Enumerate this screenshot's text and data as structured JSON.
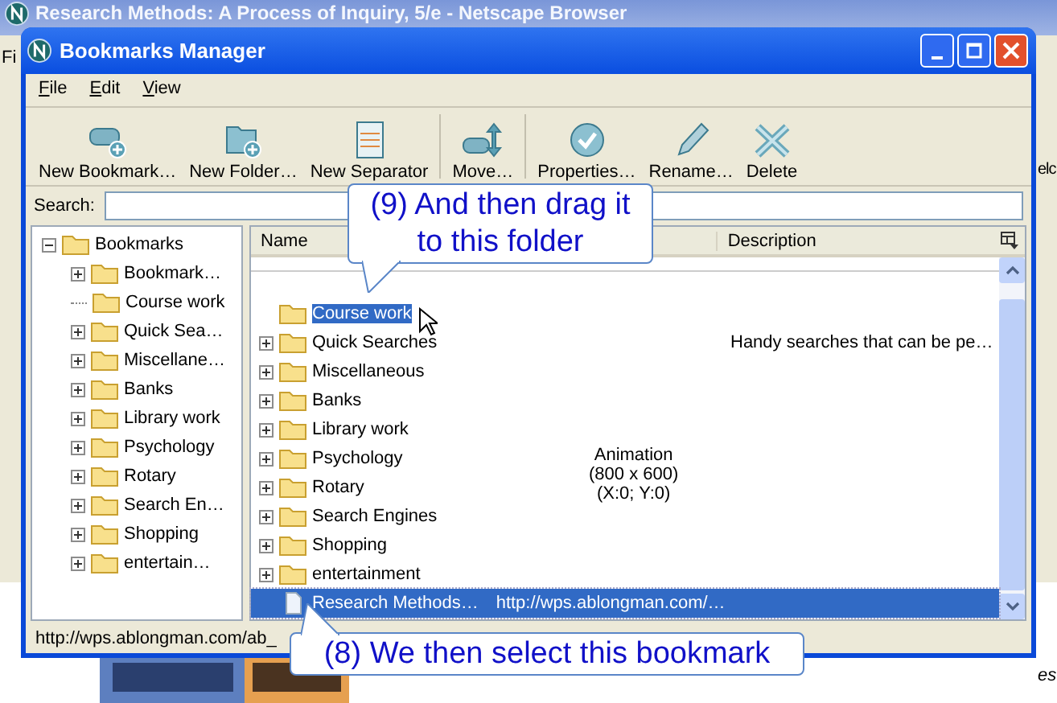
{
  "browser": {
    "title": "Research Methods: A Process of Inquiry, 5/e - Netscape Browser",
    "menu_fragment": "Fi",
    "side_fragment": "elc",
    "bottom_fragment": "es"
  },
  "dialog": {
    "title": "Bookmarks Manager"
  },
  "menu": [
    "File",
    "Edit",
    "View"
  ],
  "toolbar": [
    {
      "label": "New Bookmark…",
      "kind": "new-bookmark",
      "separator_before": false
    },
    {
      "label": "New Folder…",
      "kind": "new-folder",
      "separator_before": false
    },
    {
      "label": "New Separator",
      "kind": "new-separator",
      "separator_before": false
    },
    {
      "label": "Move…",
      "kind": "move",
      "separator_before": true
    },
    {
      "label": "Properties…",
      "kind": "properties",
      "separator_before": true
    },
    {
      "label": "Rename…",
      "kind": "rename",
      "separator_before": false
    },
    {
      "label": "Delete",
      "kind": "delete",
      "separator_before": false
    }
  ],
  "search": {
    "label": "Search:"
  },
  "tree": {
    "label": "Bookmarks",
    "expanded": true,
    "children": [
      {
        "label": "Bookmark…",
        "expandable": true
      },
      {
        "label": "Course work",
        "expandable": false
      },
      {
        "label": "Quick Sea…",
        "expandable": true
      },
      {
        "label": "Miscellane…",
        "expandable": true
      },
      {
        "label": "Banks",
        "expandable": true
      },
      {
        "label": "Library work",
        "expandable": true
      },
      {
        "label": "Psychology",
        "expandable": true
      },
      {
        "label": "Rotary",
        "expandable": true
      },
      {
        "label": "Search En…",
        "expandable": true
      },
      {
        "label": "Shopping",
        "expandable": true
      },
      {
        "label": "entertain…",
        "expandable": true
      }
    ]
  },
  "list": {
    "columns": [
      "Name",
      "Description"
    ],
    "rows": [
      {
        "kind": "folder",
        "name": "Course work",
        "expandable": false,
        "drop_target": true,
        "selected": false
      },
      {
        "kind": "folder",
        "name": "Quick Searches",
        "expandable": true,
        "drop_target": false,
        "selected": false,
        "description": "Handy searches that can be pe…"
      },
      {
        "kind": "folder",
        "name": "Miscellaneous",
        "expandable": true,
        "drop_target": false,
        "selected": false
      },
      {
        "kind": "folder",
        "name": "Banks",
        "expandable": true,
        "drop_target": false,
        "selected": false
      },
      {
        "kind": "folder",
        "name": "Library work",
        "expandable": true,
        "drop_target": false,
        "selected": false
      },
      {
        "kind": "folder",
        "name": "Psychology",
        "expandable": true,
        "drop_target": false,
        "selected": false
      },
      {
        "kind": "folder",
        "name": "Rotary",
        "expandable": true,
        "drop_target": false,
        "selected": false
      },
      {
        "kind": "folder",
        "name": "Search Engines",
        "expandable": true,
        "drop_target": false,
        "selected": false
      },
      {
        "kind": "folder",
        "name": "Shopping",
        "expandable": true,
        "drop_target": false,
        "selected": false
      },
      {
        "kind": "folder",
        "name": "entertainment",
        "expandable": true,
        "drop_target": false,
        "selected": false
      },
      {
        "kind": "bookmark",
        "name": "Research Methods…",
        "location": "http://wps.ablongman.com/…",
        "expandable": false,
        "drop_target": false,
        "selected": true
      }
    ],
    "overlay_note": [
      "Animation",
      "(800 x 600)",
      "(X:0; Y:0)"
    ]
  },
  "status_bar": "http://wps.ablongman.com/ab_",
  "callouts": [
    {
      "text": "(9) And then drag it to this folder",
      "kind": "tail-down"
    },
    {
      "text": "(8) We then select this bookmark",
      "kind": "tail-up"
    }
  ]
}
